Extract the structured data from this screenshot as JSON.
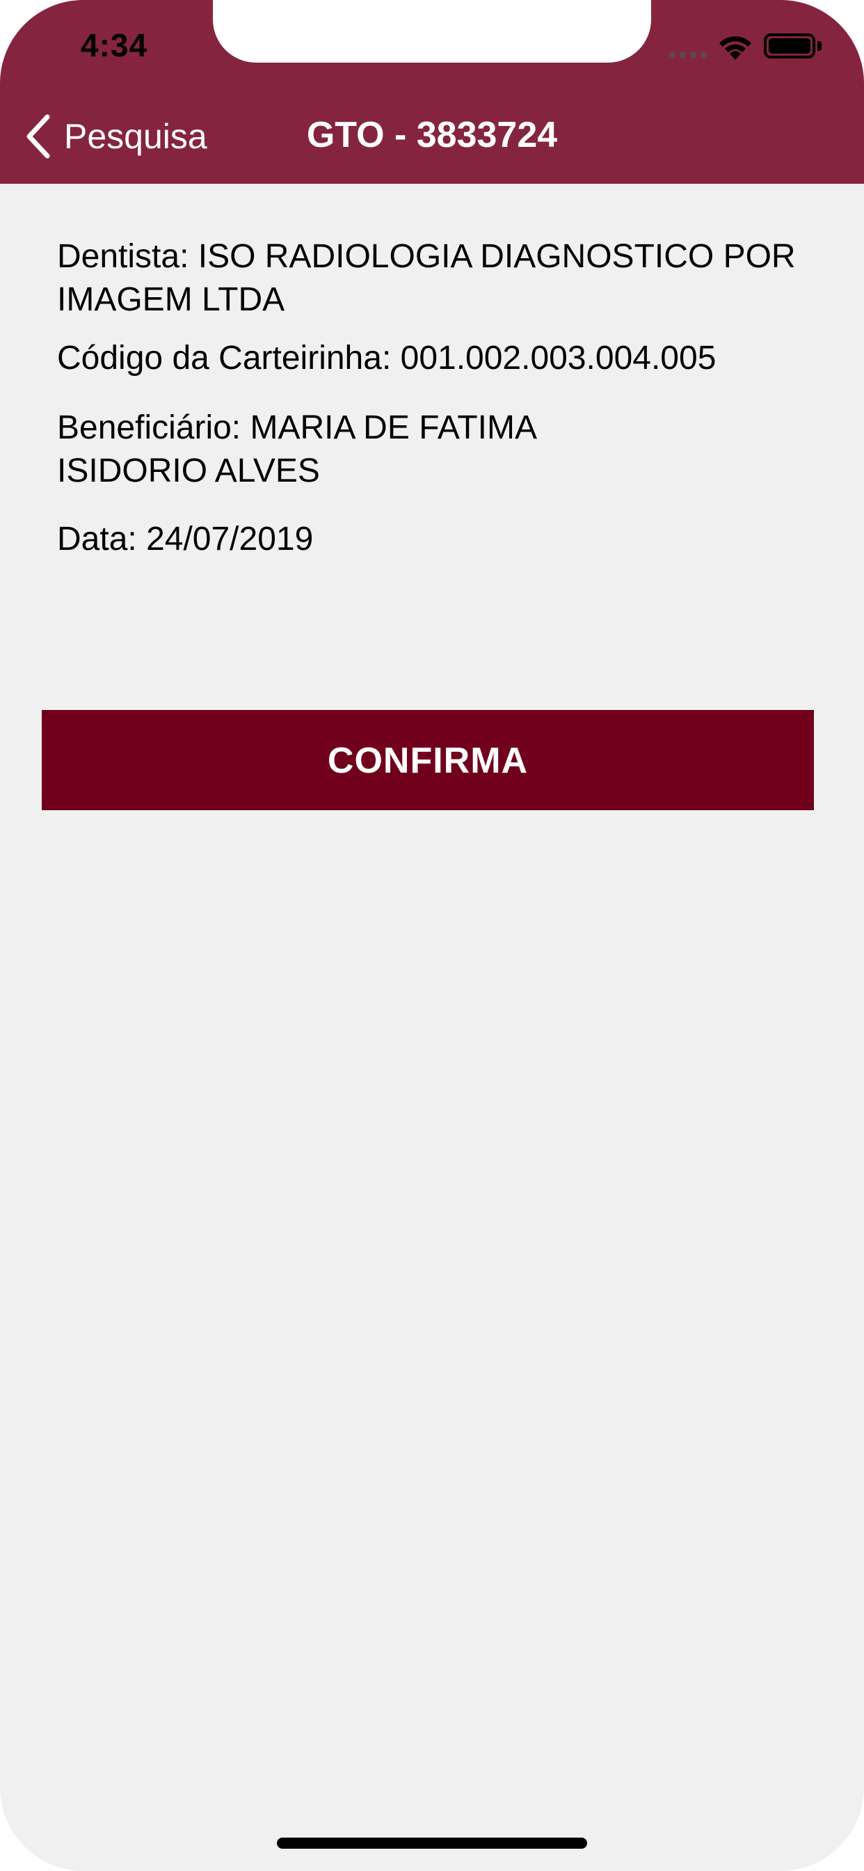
{
  "status_bar": {
    "time": "4:34"
  },
  "nav": {
    "back_label": "Pesquisa",
    "title": "GTO - 3833724"
  },
  "details": {
    "dentista": "Dentista: ISO RADIOLOGIA DIAGNOSTICO POR IMAGEM LTDA",
    "codigo_carteirinha": "Código da Carteirinha: 001.002.003.004.005",
    "beneficiario_line1": "Beneficiário: MARIA DE FATIMA",
    "beneficiario_line2": "ISIDORIO ALVES",
    "data": "Data: 24/07/2019"
  },
  "actions": {
    "confirm_label": "CONFIRMA"
  },
  "colors": {
    "header": "#85243e",
    "button": "#71001d",
    "background": "#f0f0f0",
    "text": "#000000"
  },
  "icons": {
    "back": "chevron-left-icon",
    "wifi": "wifi-icon",
    "battery": "battery-icon",
    "signal": "cellular-signal-icon"
  }
}
